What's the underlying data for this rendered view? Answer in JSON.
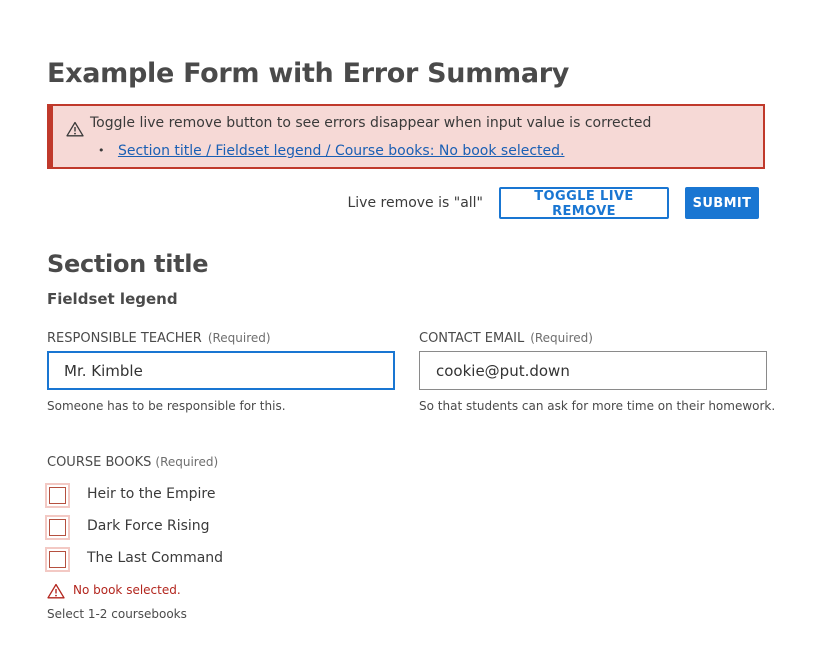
{
  "form": {
    "title": "Example Form with Error Summary"
  },
  "error_summary": {
    "message": "Toggle live remove button to see errors disappear when input value is corrected",
    "items": [
      {
        "link": "Section title / Fieldset legend / Course books: No book selected."
      }
    ]
  },
  "toolbar": {
    "live_status": "Live remove is \"all\"",
    "toggle_label": "Toggle live remove",
    "submit_label": "Submit"
  },
  "section": {
    "title": "Section title",
    "legend": "Fieldset legend"
  },
  "fields": {
    "teacher": {
      "label": "Responsible teacher",
      "required": "(Required)",
      "value": "Mr. Kimble",
      "help": "Someone has to be responsible for this."
    },
    "email": {
      "label": "Contact email",
      "required": "(Required)",
      "value": "cookie@put.down",
      "help": "So that students can ask for more time on their homework."
    },
    "books": {
      "label": "Course books",
      "required": "(Required)",
      "options": [
        "Heir to the Empire",
        "Dark Force Rising",
        "The Last Command"
      ],
      "checked": [
        false,
        false,
        false
      ],
      "error": "No book selected.",
      "help": "Select 1-2 coursebooks"
    }
  },
  "colors": {
    "primary": "#1976d2",
    "error": "#c0392b",
    "error_background": "#f6d9d6",
    "link": "#1a5fb4"
  },
  "icons": {
    "summary": "warning-triangle-icon",
    "field_error": "warning-triangle-icon"
  }
}
